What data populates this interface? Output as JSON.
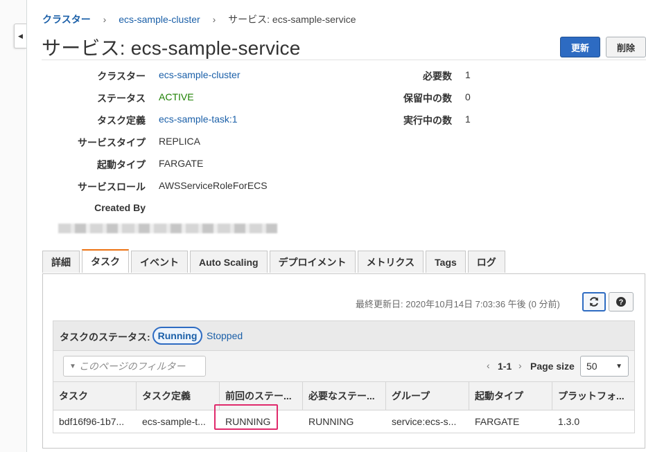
{
  "breadcrumb": {
    "root": "クラスター",
    "sep": "›",
    "cluster": "ecs-sample-cluster",
    "current": "サービス: ecs-sample-service"
  },
  "title": "サービス: ecs-sample-service",
  "buttons": {
    "update": "更新",
    "delete": "削除"
  },
  "details_left": [
    {
      "label": "クラスター",
      "value": "ecs-sample-cluster"
    },
    {
      "label": "ステータス",
      "value": "ACTIVE"
    },
    {
      "label": "タスク定義",
      "value": "ecs-sample-task:1"
    },
    {
      "label": "サービスタイプ",
      "value": "REPLICA"
    },
    {
      "label": "起動タイプ",
      "value": "FARGATE"
    },
    {
      "label": "サービスロール",
      "value": "AWSServiceRoleForECS"
    },
    {
      "label": "Created By",
      "value": ""
    }
  ],
  "details_right": [
    {
      "label": "必要数",
      "value": "1"
    },
    {
      "label": "保留中の数",
      "value": "0"
    },
    {
      "label": "実行中の数",
      "value": "1"
    }
  ],
  "tabs": [
    "詳細",
    "タスク",
    "イベント",
    "Auto Scaling",
    "デプロイメント",
    "メトリクス",
    "Tags",
    "ログ"
  ],
  "active_tab": "タスク",
  "last_updated": "最終更新日: 2020年10月14日 7:03:36 午後 (0 分前)",
  "filter": {
    "label": "タスクのステータス:",
    "running": "Running",
    "stopped": "Stopped",
    "placeholder": "このページのフィルター"
  },
  "pager": {
    "prev": "‹",
    "range": "1-1",
    "next": "›",
    "page_size_label": "Page size",
    "page_size": "50"
  },
  "table": {
    "columns": [
      "タスク",
      "タスク定義",
      "前回のステー...",
      "必要なステー...",
      "グループ",
      "起動タイプ",
      "プラットフォ..."
    ],
    "rows": [
      [
        "bdf16f96-1b7...",
        "ecs-sample-t...",
        "RUNNING",
        "RUNNING",
        "service:ecs-s...",
        "FARGATE",
        "1.3.0"
      ]
    ]
  },
  "colors": {
    "link": "#1a5fa8",
    "active": "#1d8102",
    "primary_button": "#2d6bc2",
    "tab_accent": "#ec7211",
    "highlight_box": "#e0296b"
  },
  "icons": {
    "refresh": "refresh-icon",
    "help": "help-icon",
    "filter": "filter-icon",
    "collapse": "collapse-left-icon"
  }
}
